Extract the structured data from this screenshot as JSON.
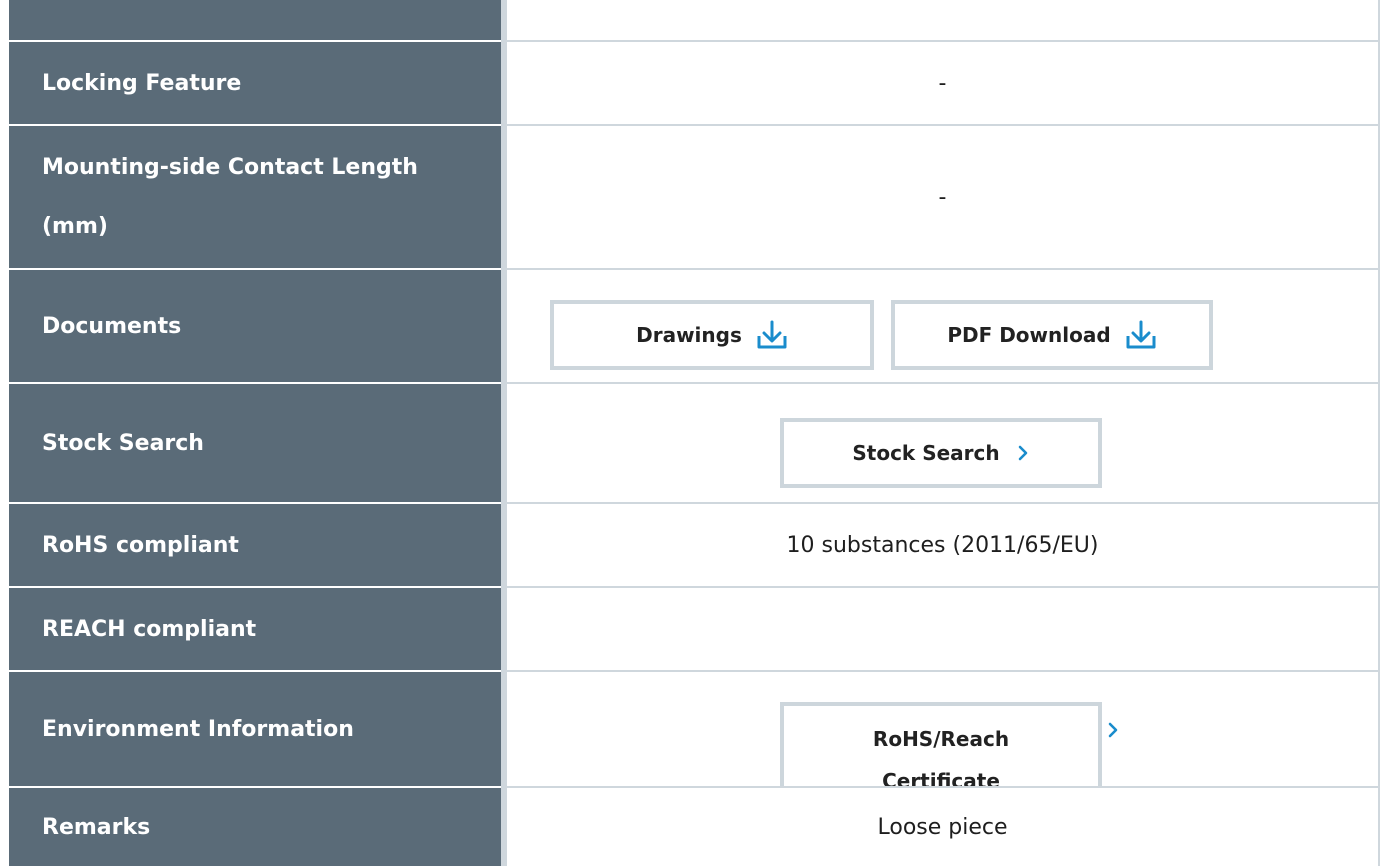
{
  "rows": {
    "locking": {
      "label": "Locking Feature",
      "value": "-"
    },
    "contact_length": {
      "label_line1": "Mounting-side Contact Length",
      "label_line2": "(mm)",
      "value": "-"
    },
    "documents": {
      "label": "Documents",
      "drawings_label": "Drawings",
      "pdf_label": "PDF Download"
    },
    "stock": {
      "label": "Stock Search",
      "button_label": "Stock Search"
    },
    "rohs": {
      "label": "RoHS compliant",
      "value": "10 substances (2011/65/EU)"
    },
    "reach": {
      "label": "REACH compliant",
      "value": ""
    },
    "environment": {
      "label": "Environment Information",
      "button_line1": "RoHS/Reach",
      "button_line2": "Certificate"
    },
    "remarks": {
      "label": "Remarks",
      "value": "Loose piece"
    }
  },
  "colors": {
    "label_bg": "#5a6b78",
    "border": "#cfd7dd",
    "accent": "#1a8ccc"
  },
  "icons": {
    "download": "download-icon",
    "chevron": "chevron-right-icon"
  }
}
